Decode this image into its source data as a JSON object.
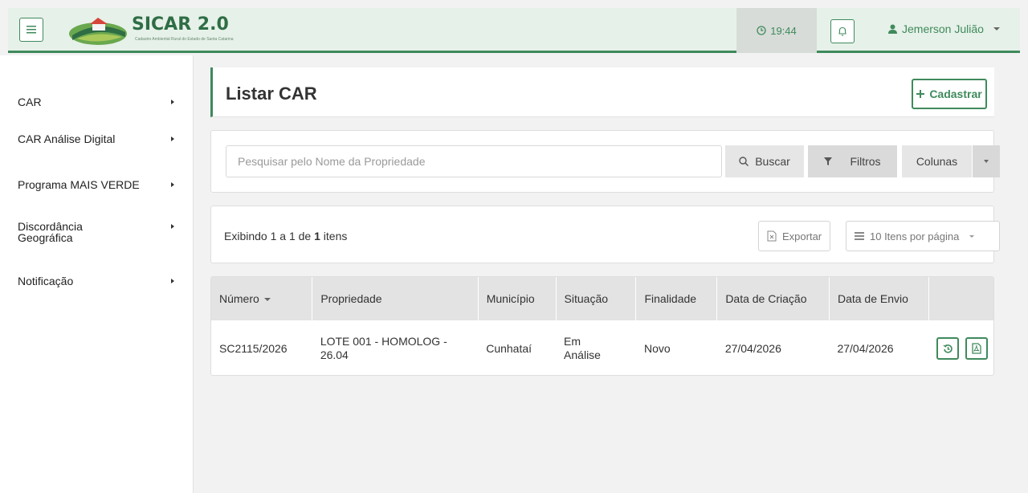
{
  "app": {
    "logo_title": "SICAR 2.0",
    "logo_subtitle": "Cadastro Ambiental Rural do Estado de Santa Catarina"
  },
  "topbar": {
    "clock_time": "19:44",
    "user_name": "Jemerson Julião"
  },
  "sidebar": {
    "items": [
      {
        "label": "CAR"
      },
      {
        "label": "CAR Análise Digital"
      },
      {
        "label": "Programa MAIS VERDE"
      },
      {
        "label": "Discordância Geográfica"
      },
      {
        "label": "Notificação"
      }
    ]
  },
  "page": {
    "title": "Listar CAR",
    "cadastrar_label": "Cadastrar"
  },
  "search": {
    "placeholder": "Pesquisar pelo Nome da Propriedade",
    "buscar_label": "Buscar",
    "filtros_label": "Filtros",
    "colunas_label": "Colunas"
  },
  "info": {
    "prefix": "Exibindo 1 a 1 de ",
    "total": "1",
    "suffix": " itens",
    "exportar_label": "Exportar",
    "per_page_label": "10 Itens por página"
  },
  "table": {
    "headers": {
      "numero": "Número",
      "propriedade": "Propriedade",
      "municipio": "Município",
      "situacao": "Situação",
      "finalidade": "Finalidade",
      "data_criacao": "Data de Criação",
      "data_envio": "Data de Envio"
    },
    "rows": [
      {
        "numero": "SC2115/2026",
        "propriedade": "LOTE 001 - HOMOLOG - 26.04",
        "municipio": "Cunhataí",
        "situacao": "Em Análise",
        "finalidade": "Novo",
        "data_criacao": "27/04/2026",
        "data_envio": "27/04/2026"
      }
    ]
  },
  "colors": {
    "brand_green": "#3f8a5c",
    "topbar_bg": "#e6f1e9"
  }
}
